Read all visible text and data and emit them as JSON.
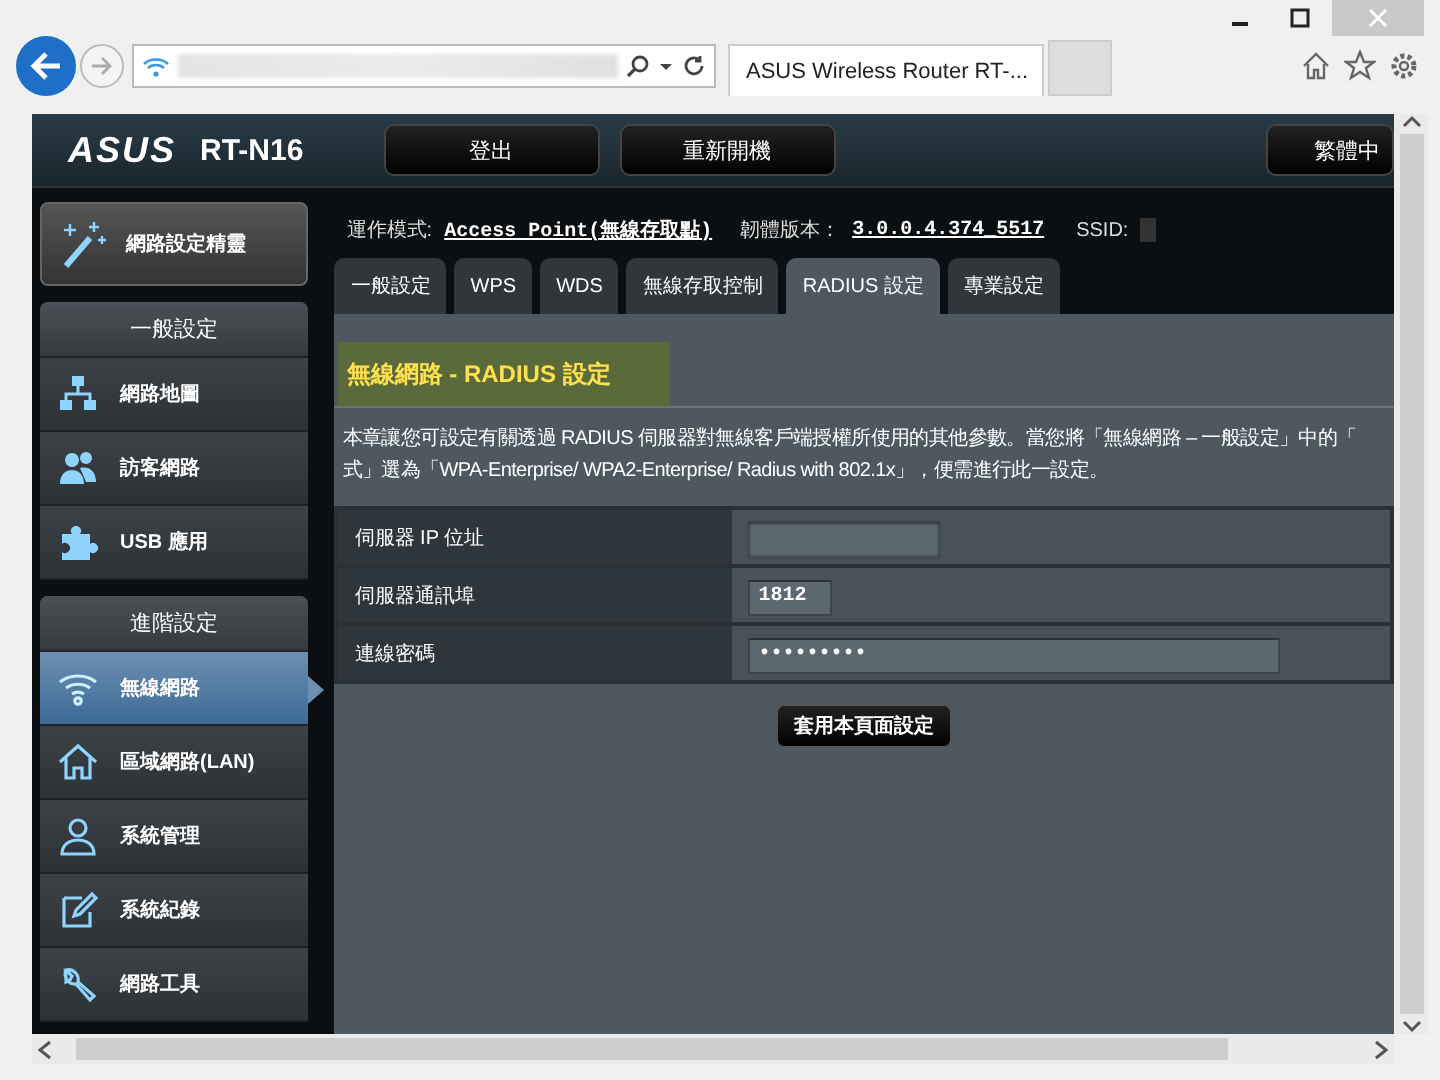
{
  "browser": {
    "tab_title": "ASUS Wireless Router RT-..."
  },
  "header": {
    "logo": "ASUS",
    "model": "RT-N16",
    "buttons": [
      "登出",
      "重新開機"
    ],
    "language": "繁體中"
  },
  "sidebar": {
    "wizard": "網路設定精靈",
    "sections": [
      {
        "title": "一般設定",
        "items": [
          {
            "label": "網路地圖",
            "kind": "network",
            "selected": false
          },
          {
            "label": "訪客網路",
            "kind": "guests",
            "selected": false
          },
          {
            "label": "USB 應用",
            "kind": "puzzle",
            "selected": false
          }
        ]
      },
      {
        "title": "進階設定",
        "items": [
          {
            "label": "無線網路",
            "kind": "wifi",
            "selected": true
          },
          {
            "label": "區域網路(LAN)",
            "kind": "home",
            "selected": false
          },
          {
            "label": "系統管理",
            "kind": "user",
            "selected": false
          },
          {
            "label": "系統紀錄",
            "kind": "edit",
            "selected": false
          },
          {
            "label": "網路工具",
            "kind": "wrench",
            "selected": false
          }
        ]
      }
    ]
  },
  "status": {
    "mode_label": "運作模式:",
    "mode_value": "Access Point(無線存取點)",
    "firmware_label": "韌體版本：",
    "firmware_value": "3.0.0.4.374_5517",
    "ssid_label": "SSID:"
  },
  "tabs": [
    {
      "label": "一般設定",
      "selected": false
    },
    {
      "label": "WPS",
      "selected": false
    },
    {
      "label": "WDS",
      "selected": false
    },
    {
      "label": "無線存取控制",
      "selected": false
    },
    {
      "label": "RADIUS 設定",
      "selected": true
    },
    {
      "label": "專業設定",
      "selected": false
    }
  ],
  "panel": {
    "title": "無線網路 - RADIUS 設定",
    "description": [
      "本章讓您可設定有關透過 RADIUS 伺服器對無線客戶端授權所使用的其他參數。當您將「無線網路 – 一般設定」中的「",
      "式」選為「WPA-Enterprise/ WPA2-Enterprise/ Radius with 802.1x」，便需進行此一設定。"
    ],
    "fields": [
      {
        "label": "伺服器 IP 位址",
        "kind": "redacted"
      },
      {
        "label": "伺服器通訊埠",
        "kind": "short",
        "value": "1812"
      },
      {
        "label": "連線密碼",
        "kind": "long",
        "value": "•••••••••"
      }
    ],
    "apply_button": "套用本頁面設定"
  }
}
